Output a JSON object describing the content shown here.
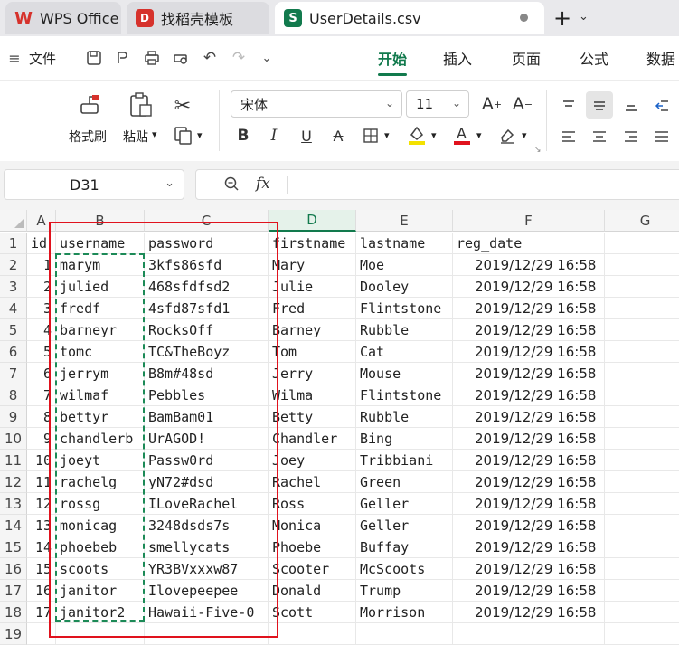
{
  "tabs": [
    {
      "label": "WPS Office",
      "icon": "wps-logo-icon",
      "state": "inactive"
    },
    {
      "label": "找稻壳模板",
      "icon": "docer-logo-icon",
      "state": "inactive"
    },
    {
      "label": "UserDetails.csv",
      "icon": "spreadsheet-s-icon",
      "state": "active"
    }
  ],
  "menu": {
    "file_label": "文件",
    "items": [
      "开始",
      "插入",
      "页面",
      "公式",
      "数据"
    ],
    "active": "开始"
  },
  "ribbon": {
    "format_painter_label": "格式刷",
    "paste_label": "粘贴",
    "font_name": "宋体",
    "font_size": "11"
  },
  "formula_bar": {
    "cell_ref": "D31",
    "fx_label": "fx",
    "formula_value": ""
  },
  "grid": {
    "columns": [
      "A",
      "B",
      "C",
      "D",
      "E",
      "F",
      "G"
    ],
    "selected_column": "D",
    "row_numbers": [
      "1",
      "2",
      "3",
      "4",
      "5",
      "6",
      "7",
      "8",
      "9",
      "10",
      "11",
      "12",
      "13",
      "14",
      "15",
      "16",
      "17",
      "18",
      "19"
    ],
    "header_row": [
      "id",
      "username",
      "password",
      "firstname",
      "lastname",
      "reg_date"
    ],
    "rows": [
      [
        "1",
        "marym",
        "3kfs86sfd",
        "Mary",
        "Moe",
        "2019/12/29  16:58"
      ],
      [
        "2",
        "julied",
        "468sfdfsd2",
        "Julie",
        "Dooley",
        "2019/12/29  16:58"
      ],
      [
        "3",
        "fredf",
        "4sfd87sfd1",
        "Fred",
        "Flintstone",
        "2019/12/29  16:58"
      ],
      [
        "4",
        "barneyr",
        "RocksOff",
        "Barney",
        "Rubble",
        "2019/12/29  16:58"
      ],
      [
        "5",
        "tomc",
        "TC&TheBoyz",
        "Tom",
        "Cat",
        "2019/12/29  16:58"
      ],
      [
        "6",
        "jerrym",
        "B8m#48sd",
        "Jerry",
        "Mouse",
        "2019/12/29  16:58"
      ],
      [
        "7",
        "wilmaf",
        "Pebbles",
        "Wilma",
        "Flintstone",
        "2019/12/29  16:58"
      ],
      [
        "8",
        "bettyr",
        "BamBam01",
        "Betty",
        "Rubble",
        "2019/12/29  16:58"
      ],
      [
        "9",
        "chandlerb",
        "UrAGOD!",
        "Chandler",
        "Bing",
        "2019/12/29  16:58"
      ],
      [
        "10",
        "joeyt",
        "Passw0rd",
        "Joey",
        "Tribbiani",
        "2019/12/29  16:58"
      ],
      [
        "11",
        "rachelg",
        "yN72#dsd",
        "Rachel",
        "Green",
        "2019/12/29  16:58"
      ],
      [
        "12",
        "rossg",
        "ILoveRachel",
        "Ross",
        "Geller",
        "2019/12/29  16:58"
      ],
      [
        "13",
        "monicag",
        "3248dsds7s",
        "Monica",
        "Geller",
        "2019/12/29  16:58"
      ],
      [
        "14",
        "phoebeb",
        "smellycats",
        "Phoebe",
        "Buffay",
        "2019/12/29  16:58"
      ],
      [
        "15",
        "scoots",
        "YR3BVxxxw87",
        "Scooter",
        "McScoots",
        "2019/12/29  16:58"
      ],
      [
        "16",
        "janitor",
        "Ilovepeepee",
        "Donald",
        "Trump",
        "2019/12/29  16:58"
      ],
      [
        "17",
        "janitor2",
        "Hawaii-Five-0",
        "Scott",
        "Morrison",
        "2019/12/29  16:58"
      ]
    ]
  },
  "colors": {
    "accent": "#127a4d",
    "highlight_box": "#e0121d",
    "copy_marquee": "#1c8a57"
  }
}
